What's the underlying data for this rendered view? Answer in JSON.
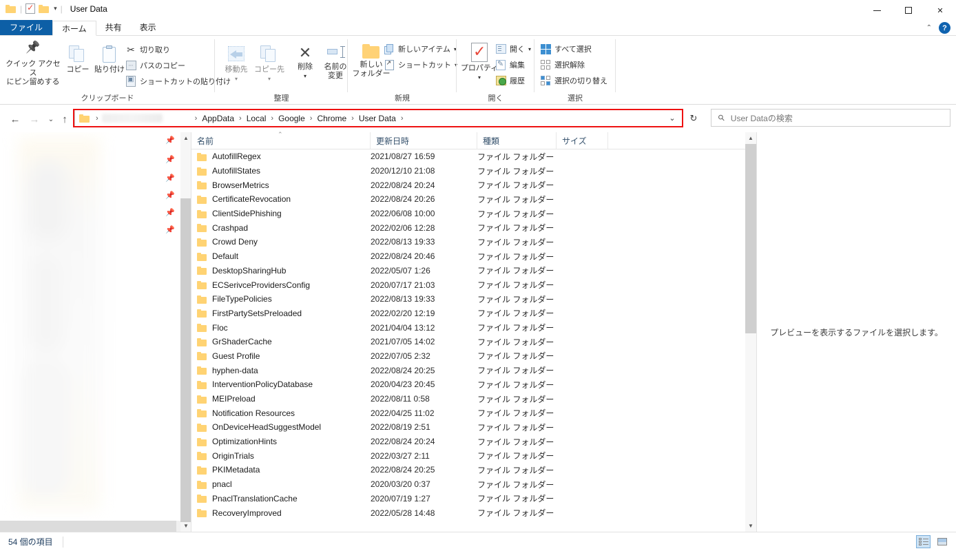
{
  "window": {
    "title": "User Data",
    "quick_access": {
      "folder_icon": "folder-icon",
      "properties_icon": "properties-checkmark-icon",
      "new_folder_icon": "new-folder-icon",
      "customize_caret": "▾"
    },
    "controls": {
      "minimize": "minimize-icon",
      "maximize": "maximize-icon",
      "close": "✕"
    }
  },
  "ribbon": {
    "tabs": [
      {
        "label": "ファイル",
        "id": "file"
      },
      {
        "label": "ホーム",
        "id": "home"
      },
      {
        "label": "共有",
        "id": "share"
      },
      {
        "label": "表示",
        "id": "view"
      }
    ],
    "active_tab": "ホーム",
    "collapse_caret": "⌃",
    "help_label": "?",
    "groups": [
      {
        "name": "クリップボード",
        "big_buttons": [
          {
            "label": "クイック アクセス\nにピン留めする",
            "line1": "クイック アクセス",
            "line2": "にピン留めする",
            "icon": "pin-icon"
          },
          {
            "label": "コピー",
            "icon": "copy-icon"
          },
          {
            "label": "貼り付け",
            "icon": "paste-icon"
          }
        ],
        "small_buttons": [
          {
            "label": "切り取り",
            "icon": "scissors-icon"
          },
          {
            "label": "パスのコピー",
            "icon": "copy-path-icon"
          },
          {
            "label": "ショートカットの貼り付け",
            "icon": "paste-shortcut-icon"
          }
        ]
      },
      {
        "name": "整理",
        "big_buttons": [
          {
            "label": "移動先",
            "icon": "move-to-icon",
            "caret": "▾"
          },
          {
            "label": "コピー先",
            "icon": "copy-to-icon",
            "caret": "▾"
          },
          {
            "label": "削除",
            "icon": "delete-icon",
            "caret": "▾"
          },
          {
            "line1": "名前の",
            "line2": "変更",
            "label": "名前の変更",
            "icon": "rename-icon"
          }
        ]
      },
      {
        "name": "新規",
        "big_buttons": [
          {
            "line1": "新しい",
            "line2": "フォルダー",
            "label": "新しいフォルダー",
            "icon": "new-folder-icon"
          }
        ],
        "small_buttons": [
          {
            "label": "新しいアイテム",
            "icon": "new-item-icon",
            "caret": "▾"
          },
          {
            "label": "ショートカット",
            "icon": "shortcut-icon",
            "caret": "▾"
          }
        ]
      },
      {
        "name": "開く",
        "big_buttons": [
          {
            "label": "プロパティ",
            "icon": "properties-icon",
            "caret": "▾"
          }
        ],
        "small_buttons": [
          {
            "label": "開く",
            "icon": "open-icon",
            "caret": "▾"
          },
          {
            "label": "編集",
            "icon": "edit-icon"
          },
          {
            "label": "履歴",
            "icon": "history-icon"
          }
        ]
      },
      {
        "name": "選択",
        "small_buttons": [
          {
            "label": "すべて選択",
            "icon": "select-all-icon"
          },
          {
            "label": "選択解除",
            "icon": "select-none-icon"
          },
          {
            "label": "選択の切り替え",
            "icon": "invert-selection-icon"
          }
        ]
      }
    ]
  },
  "navbar": {
    "back_icon": "←",
    "forward_icon": "→",
    "recent_icon": "⌄",
    "up_icon": "↑",
    "highlight_color": "#ee1111",
    "breadcrumbs": [
      {
        "label": "",
        "redacted": true,
        "icon": "folder-icon"
      },
      {
        "label": "AppData"
      },
      {
        "label": "Local"
      },
      {
        "label": "Google"
      },
      {
        "label": "Chrome"
      },
      {
        "label": "User Data"
      }
    ],
    "separator": "›",
    "dropdown_icon": "⌄",
    "refresh_icon": "↻",
    "search_placeholder": "User Dataの検索",
    "search_value": "",
    "search_icon": "search-icon"
  },
  "columns": [
    {
      "label": "名前",
      "key": "name",
      "sorted": "asc"
    },
    {
      "label": "更新日時",
      "key": "date"
    },
    {
      "label": "種類",
      "key": "type"
    },
    {
      "label": "サイズ",
      "key": "size"
    }
  ],
  "files": [
    {
      "name": "AutofillRegex",
      "date": "2021/08/27 16:59",
      "type": "ファイル フォルダー",
      "size": ""
    },
    {
      "name": "AutofillStates",
      "date": "2020/12/10 21:08",
      "type": "ファイル フォルダー",
      "size": ""
    },
    {
      "name": "BrowserMetrics",
      "date": "2022/08/24 20:24",
      "type": "ファイル フォルダー",
      "size": ""
    },
    {
      "name": "CertificateRevocation",
      "date": "2022/08/24 20:26",
      "type": "ファイル フォルダー",
      "size": ""
    },
    {
      "name": "ClientSidePhishing",
      "date": "2022/06/08 10:00",
      "type": "ファイル フォルダー",
      "size": ""
    },
    {
      "name": "Crashpad",
      "date": "2022/02/06 12:28",
      "type": "ファイル フォルダー",
      "size": ""
    },
    {
      "name": "Crowd Deny",
      "date": "2022/08/13 19:33",
      "type": "ファイル フォルダー",
      "size": ""
    },
    {
      "name": "Default",
      "date": "2022/08/24 20:46",
      "type": "ファイル フォルダー",
      "size": ""
    },
    {
      "name": "DesktopSharingHub",
      "date": "2022/05/07 1:26",
      "type": "ファイル フォルダー",
      "size": ""
    },
    {
      "name": "ECSerivceProvidersConfig",
      "date": "2020/07/17 21:03",
      "type": "ファイル フォルダー",
      "size": ""
    },
    {
      "name": "FileTypePolicies",
      "date": "2022/08/13 19:33",
      "type": "ファイル フォルダー",
      "size": ""
    },
    {
      "name": "FirstPartySetsPreloaded",
      "date": "2022/02/20 12:19",
      "type": "ファイル フォルダー",
      "size": ""
    },
    {
      "name": "Floc",
      "date": "2021/04/04 13:12",
      "type": "ファイル フォルダー",
      "size": ""
    },
    {
      "name": "GrShaderCache",
      "date": "2021/07/05 14:02",
      "type": "ファイル フォルダー",
      "size": ""
    },
    {
      "name": "Guest Profile",
      "date": "2022/07/05 2:32",
      "type": "ファイル フォルダー",
      "size": ""
    },
    {
      "name": "hyphen-data",
      "date": "2022/08/24 20:25",
      "type": "ファイル フォルダー",
      "size": ""
    },
    {
      "name": "InterventionPolicyDatabase",
      "date": "2020/04/23 20:45",
      "type": "ファイル フォルダー",
      "size": ""
    },
    {
      "name": "MEIPreload",
      "date": "2022/08/11 0:58",
      "type": "ファイル フォルダー",
      "size": ""
    },
    {
      "name": "Notification Resources",
      "date": "2022/04/25 11:02",
      "type": "ファイル フォルダー",
      "size": ""
    },
    {
      "name": "OnDeviceHeadSuggestModel",
      "date": "2022/08/19 2:51",
      "type": "ファイル フォルダー",
      "size": ""
    },
    {
      "name": "OptimizationHints",
      "date": "2022/08/24 20:24",
      "type": "ファイル フォルダー",
      "size": ""
    },
    {
      "name": "OriginTrials",
      "date": "2022/03/27 2:11",
      "type": "ファイル フォルダー",
      "size": ""
    },
    {
      "name": "PKIMetadata",
      "date": "2022/08/24 20:25",
      "type": "ファイル フォルダー",
      "size": ""
    },
    {
      "name": "pnacl",
      "date": "2020/03/20 0:37",
      "type": "ファイル フォルダー",
      "size": ""
    },
    {
      "name": "PnaclTranslationCache",
      "date": "2020/07/19 1:27",
      "type": "ファイル フォルダー",
      "size": ""
    },
    {
      "name": "RecoveryImproved",
      "date": "2022/05/28 14:48",
      "type": "ファイル フォルダー",
      "size": ""
    }
  ],
  "preview": {
    "message": "プレビューを表示するファイルを選択します。"
  },
  "status": {
    "item_count": "54 個の項目",
    "view_details_icon": "details-view-icon",
    "view_thumbnails_icon": "large-icons-view-icon",
    "selected_view": "details"
  }
}
